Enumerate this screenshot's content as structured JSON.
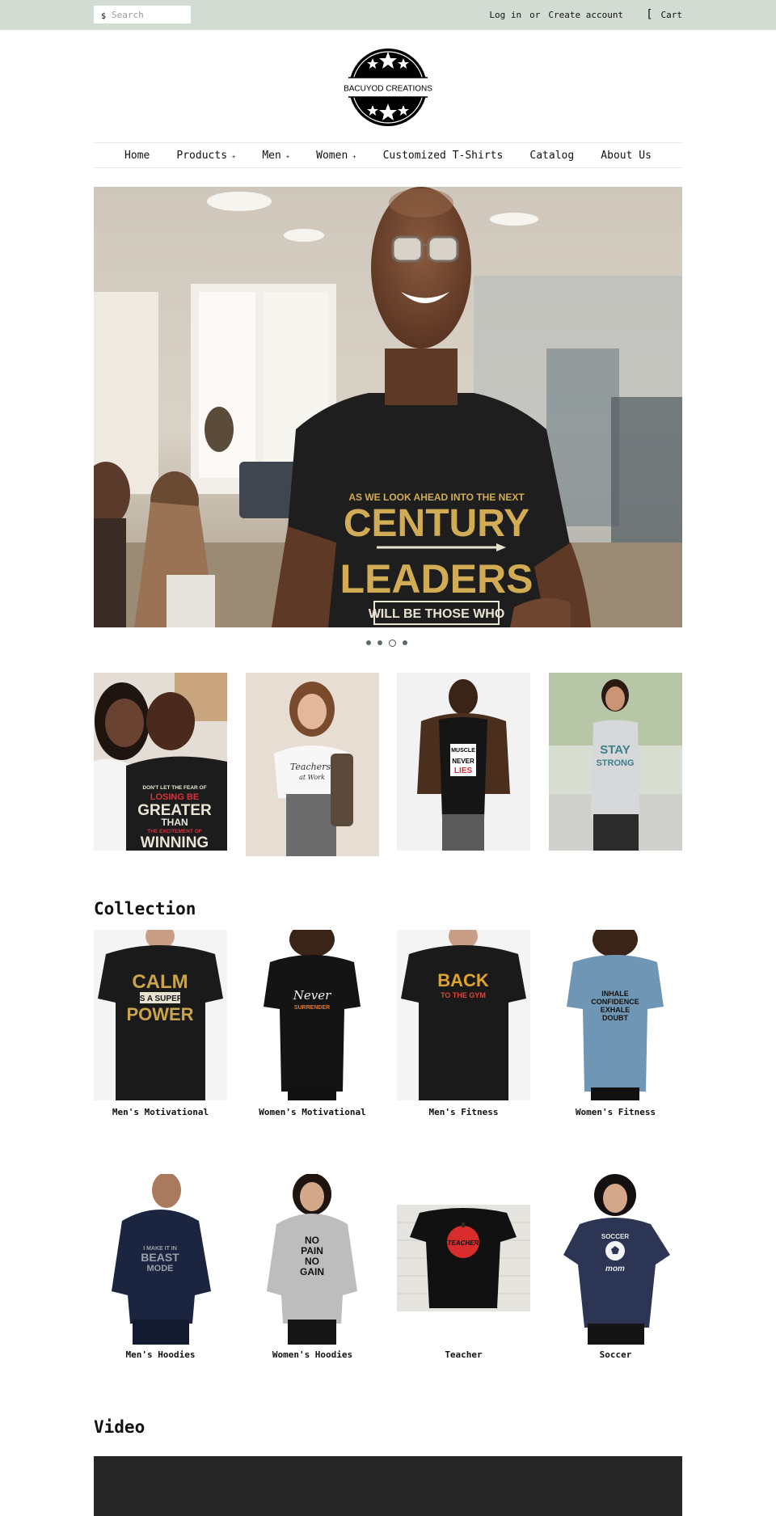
{
  "topbar": {
    "search_icon": "$",
    "search_placeholder": "Search",
    "login": "Log in",
    "or": "or",
    "create_account": "Create account",
    "cart_icon": "[",
    "cart": "Cart"
  },
  "logo": {
    "text": "BACUYOD CREATIONS",
    "icon": "star-badge-logo"
  },
  "nav": [
    {
      "label": "Home",
      "dropdown": false
    },
    {
      "label": "Products",
      "dropdown": true
    },
    {
      "label": "Men",
      "dropdown": true
    },
    {
      "label": "Women",
      "dropdown": true
    },
    {
      "label": "Customized T-Shirts",
      "dropdown": false
    },
    {
      "label": "Catalog",
      "dropdown": false
    },
    {
      "label": "About Us",
      "dropdown": false
    }
  ],
  "nav_caret": "+",
  "hero": {
    "shirt_line1": "AS WE LOOK AHEAD INTO THE NEXT",
    "shirt_line2": "CENTURY",
    "shirt_line3": "LEADERS",
    "shirt_line4": "WILL BE THOSE WHO",
    "slides": 4,
    "active_slide": 3
  },
  "promo": [
    {
      "shirt_lines": [
        "DON'T LET THE FEAR OF",
        "LOSING BE",
        "GREATER",
        "THAN",
        "THE EXCITEMENT OF",
        "WINNING"
      ]
    },
    {
      "shirt_lines": [
        "Teachers",
        "at Work"
      ]
    },
    {
      "shirt_lines": [
        "MUSCLE",
        "NEVER",
        "LIES"
      ]
    },
    {
      "shirt_lines": [
        "STAY",
        "STRONG"
      ]
    }
  ],
  "collection": {
    "heading": "Collection",
    "items": [
      {
        "title": "Men's Motivational",
        "shirt_lines": [
          "CALM",
          "IS A SUPER",
          "POWER"
        ]
      },
      {
        "title": "Women's Motivational",
        "shirt_lines": [
          "Never",
          "SURRENDER"
        ]
      },
      {
        "title": "Men's Fitness",
        "shirt_lines": [
          "BACK",
          "TO THE GYM"
        ]
      },
      {
        "title": "Women's Fitness",
        "shirt_lines": [
          "INHALE",
          "CONFIDENCE",
          "EXHALE",
          "DOUBT"
        ]
      },
      {
        "title": "Men's Hoodies",
        "shirt_lines": [
          "I MAKE IT IN",
          "BEAST",
          "MODE"
        ]
      },
      {
        "title": "Women's Hoodies",
        "shirt_lines": [
          "NO",
          "PAIN",
          "NO",
          "GAIN"
        ]
      },
      {
        "title": "Teacher",
        "shirt_lines": [
          "TEACHER"
        ]
      },
      {
        "title": "Soccer",
        "shirt_lines": [
          "SOCCER",
          "mom"
        ]
      }
    ]
  },
  "video": {
    "heading": "Video"
  },
  "colors": {
    "topbar": "#d3dcd3",
    "shirt_black": "#1c1c1c",
    "gold": "#c9a44a",
    "video_bg": "#262626"
  }
}
